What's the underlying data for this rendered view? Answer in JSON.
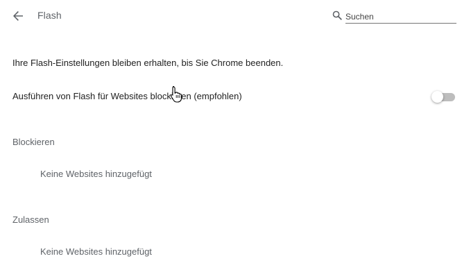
{
  "header": {
    "title": "Flash",
    "search_placeholder": "Suchen"
  },
  "content": {
    "info_text": "Ihre Flash-Einstellungen bleiben erhalten, bis Sie Chrome beenden.",
    "toggle_label": "Ausführen von Flash für Websites blockieren (empfohlen)",
    "toggle_on": false,
    "block_section": {
      "heading": "Blockieren",
      "empty_text": "Keine Websites hinzugefügt"
    },
    "allow_section": {
      "heading": "Zulassen",
      "empty_text": "Keine Websites hinzugefügt"
    }
  },
  "icons": {
    "back": "arrow-back-icon",
    "search": "search-icon",
    "cursor": "hand-pointer-cursor"
  },
  "colors": {
    "secondary_text": "#5f6368",
    "primary_text": "#212121",
    "toggle_track_off": "#bdbdbd"
  }
}
